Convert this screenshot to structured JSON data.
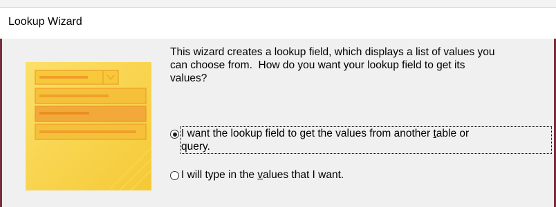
{
  "window": {
    "title": "Lookup Wizard"
  },
  "colors": {
    "body_background": "#f0f0f0",
    "illustration_yellow": "#f7d648",
    "illustration_orange": "#f0b43c",
    "border_accent": "#7a2d3a"
  },
  "illustration": {
    "icon": "lookup-list-illustration"
  },
  "description": "This wizard creates a lookup field, which displays a list of values you\ncan choose from.  How do you want your lookup field to get its\nvalues?",
  "options": [
    {
      "checked": true,
      "label_pre": "I want the lookup field to get the values from another ",
      "label_access": "t",
      "label_post": "able or\nquery."
    },
    {
      "checked": false,
      "label_pre": "I will type in the ",
      "label_access": "v",
      "label_post": "alues that I want."
    }
  ]
}
